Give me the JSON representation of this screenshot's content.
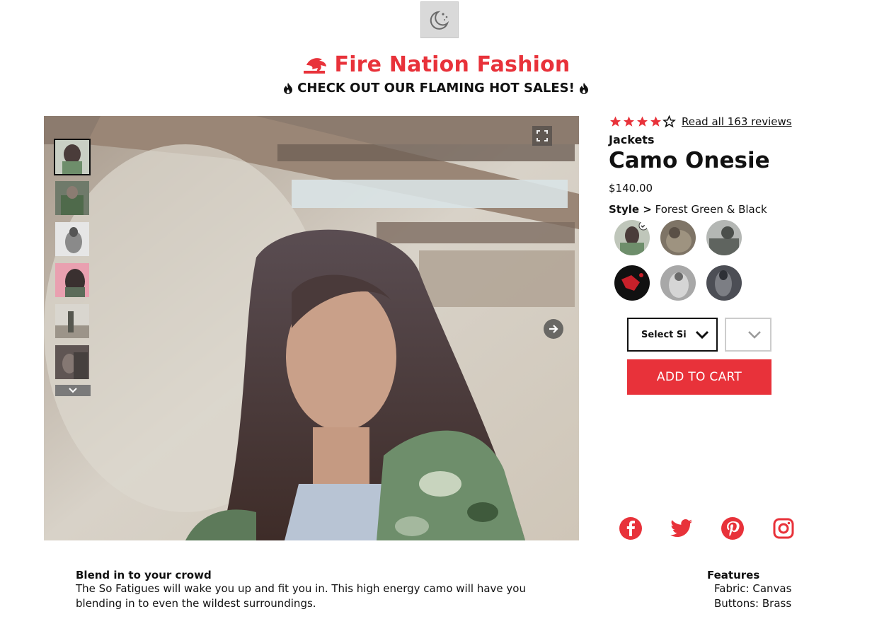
{
  "header": {
    "theme_toggle_icon": "moon-stars-icon",
    "brand_logo_icon": "dragon-logo-icon",
    "brand_name": "Fire Nation Fashion",
    "promo_text": "CHECK OUT OUR FLAMING HOT SALES!",
    "promo_icon": "flame-icon"
  },
  "colors": {
    "accent": "#e8323a",
    "text": "#111111"
  },
  "gallery": {
    "thumbnail_count": 6,
    "active_thumbnail": 1,
    "expand_icon": "expand-icon",
    "next_icon": "arrow-right-icon",
    "thumbs_down_icon": "chevron-down-icon"
  },
  "product": {
    "rating": 4,
    "rating_max": 5,
    "reviews_link": "Read all 163 reviews",
    "category": "Jackets",
    "name": "Camo Onesie",
    "price": "$140.00",
    "style_label": "Style >",
    "style_value": "Forest Green & Black",
    "style_count": 6,
    "selected_style": 1
  },
  "purchase": {
    "size_select": "Select Si",
    "qty_select": "",
    "add_to_cart": "ADD TO CART"
  },
  "social": [
    "facebook-icon",
    "twitter-icon",
    "pinterest-icon",
    "instagram-icon"
  ],
  "description": {
    "title": "Blend in to your crowd",
    "body_line1": "The So Fatigues will wake you up and fit you in. This high energy camo will have you",
    "body_line2": "blending in to even the wildest surroundings."
  },
  "features": {
    "title": "Features",
    "items": [
      "Fabric: Canvas",
      "Buttons: Brass"
    ]
  }
}
